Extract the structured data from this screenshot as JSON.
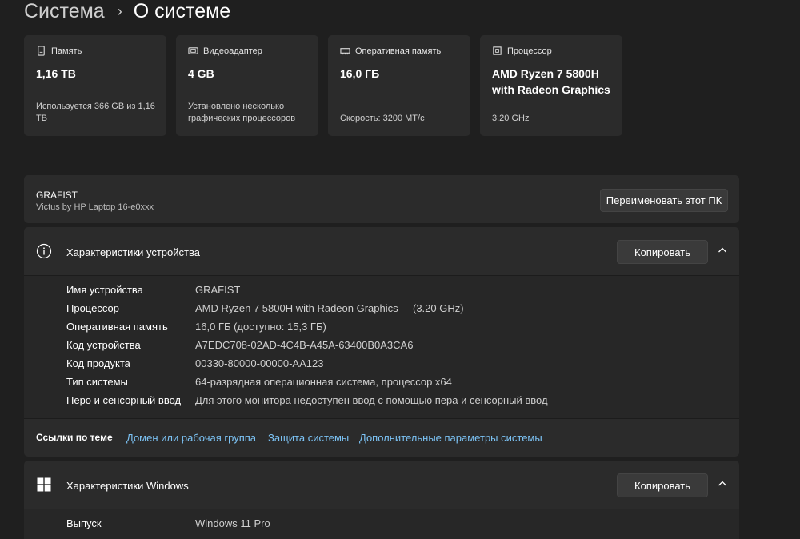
{
  "breadcrumb": {
    "parent": "Система",
    "separator": "›",
    "current": "О системе"
  },
  "cards": [
    {
      "icon": "storage-icon",
      "title": "Память",
      "value": "1,16 TB",
      "sub": "Используется 366 GB из 1,16 TB"
    },
    {
      "icon": "gpu-icon",
      "title": "Видеоадаптер",
      "value": "4 GB",
      "sub": "Установлено несколько графических процессоров"
    },
    {
      "icon": "ram-icon",
      "title": "Оперативная память",
      "value": "16,0 ГБ",
      "sub": "Скорость: 3200 MT/с"
    },
    {
      "icon": "cpu-icon",
      "title": "Процессор",
      "value": "AMD Ryzen 7 5800H with Radeon Graphics",
      "sub": "3.20 GHz"
    }
  ],
  "device": {
    "name": "GRAFIST",
    "model": "Victus by HP Laptop 16-e0xxx",
    "rename_label": "Переименовать этот ПК"
  },
  "device_specs": {
    "title": "Характеристики устройства",
    "copy_label": "Копировать",
    "rows": [
      {
        "label": "Имя устройства",
        "value": "GRAFIST",
        "extra": ""
      },
      {
        "label": "Процессор",
        "value": "AMD Ryzen 7 5800H with Radeon Graphics",
        "extra": "(3.20 GHz)"
      },
      {
        "label": "Оперативная память",
        "value": "16,0 ГБ (доступно: 15,3 ГБ)",
        "extra": ""
      },
      {
        "label": "Код устройства",
        "value": "A7EDC708-02AD-4C4B-A45A-63400B0A3CA6",
        "extra": ""
      },
      {
        "label": "Код продукта",
        "value": "00330-80000-00000-AA123",
        "extra": ""
      },
      {
        "label": "Тип системы",
        "value": "64-разрядная операционная система, процессор x64",
        "extra": ""
      },
      {
        "label": "Перо и сенсорный ввод",
        "value": "Для этого монитора недоступен ввод с помощью пера и сенсорный ввод",
        "extra": ""
      }
    ]
  },
  "related_links": {
    "title": "Ссылки по теме",
    "links": [
      "Домен или рабочая группа",
      "Защита системы",
      "Дополнительные параметры системы"
    ]
  },
  "windows_specs": {
    "title": "Характеристики Windows",
    "copy_label": "Копировать",
    "rows": [
      {
        "label": "Выпуск",
        "value": "Windows 11 Pro"
      }
    ]
  },
  "colors": {
    "background": "#1f1f1f",
    "card": "#2b2b2b",
    "link": "#7cc3f5"
  }
}
